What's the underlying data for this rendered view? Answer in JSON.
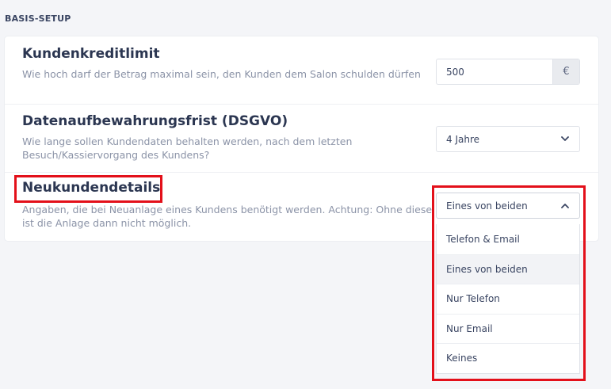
{
  "section": {
    "title": "BASIS-SETUP"
  },
  "credit_limit": {
    "title": "Kundenkreditlimit",
    "description": "Wie hoch darf der Betrag maximal sein, den Kunden dem Salon schulden dürfen",
    "value": "500",
    "currency": "€"
  },
  "retention": {
    "title": "Datenaufbewahrungsfrist (DSGVO)",
    "description": "Wie lange sollen Kundendaten behalten werden, nach dem letzten Besuch/Kassiervorgang des Kundens?",
    "selected": "4 Jahre"
  },
  "new_customer": {
    "title": "Neukundendetails",
    "description": "Angaben, die bei Neuanlage eines Kundens benötigt werden. Achtung: Ohne diese ist die Anlage dann nicht möglich.",
    "selected": "Eines von beiden",
    "options": [
      "Telefon & Email",
      "Eines von beiden",
      "Nur Telefon",
      "Nur Email",
      "Keines"
    ]
  },
  "colors": {
    "highlight": "#e3101a",
    "background": "#f4f5f8",
    "title_text": "#2b3651",
    "muted_text": "#8b93a7"
  },
  "icons": {
    "currency_addon": "euro-sign",
    "select_closed": "chevron-down-icon",
    "select_open": "chevron-up-icon"
  }
}
